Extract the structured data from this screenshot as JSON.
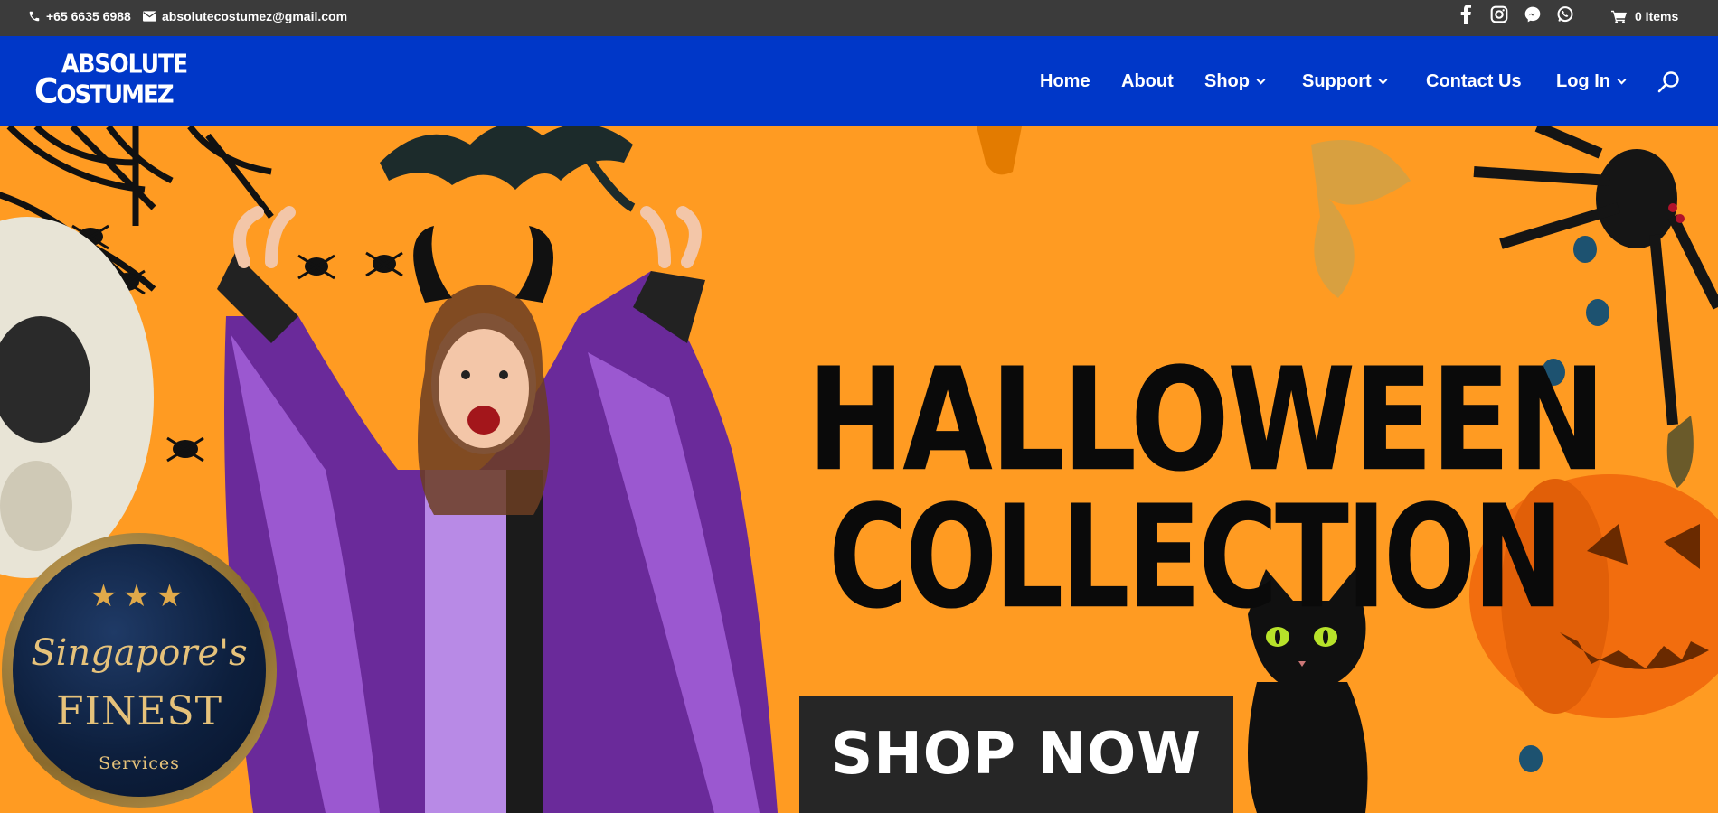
{
  "topbar": {
    "phone": "+65 6635 6988",
    "email": "absolutecostumez@gmail.com",
    "social": [
      "facebook-icon",
      "instagram-icon",
      "messenger-icon",
      "whatsapp-icon"
    ],
    "cart_label": "0 Items"
  },
  "header": {
    "logo_line1": "ABSOLUTE",
    "logo_line2_cap1": "C",
    "logo_line2_rest": "OSTUMEZ",
    "nav": [
      {
        "label": "Home"
      },
      {
        "label": "About"
      },
      {
        "label": "Shop"
      },
      {
        "label": "Support"
      },
      {
        "label": "Contact Us"
      },
      {
        "label": "Log In"
      }
    ]
  },
  "hero": {
    "headline_line1": "HALLOWEEN",
    "headline_line2": "COLLECTION",
    "cta_label": "SHOP NOW"
  },
  "badge": {
    "stars": "★★★",
    "line1": "Singapore's",
    "line2": "FINEST",
    "line3": "Services"
  },
  "colors": {
    "topbar_bg": "#3b3b3b",
    "header_bg": "#0037c8",
    "hero_bg": "#ff9b22",
    "cta_bg": "#262626"
  }
}
